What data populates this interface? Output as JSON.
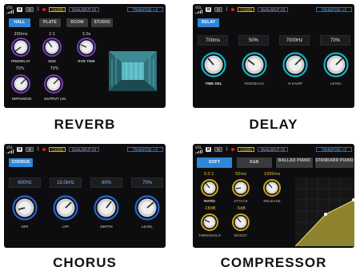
{
  "status": {
    "vol_label": "VOL",
    "h_chip": "H",
    "m_chip": "M",
    "bt_icon": "ᛒ",
    "chord": "CHORD",
    "dual": "DUAL/SPLIT CX",
    "transpose": "TRANSPOSE +0"
  },
  "reverb": {
    "tabs": [
      "HALL",
      "PLATE",
      "ROOM",
      "STUDIO"
    ],
    "values": [
      "200ms",
      "2:1",
      "3.0s",
      "70%",
      "70%"
    ],
    "labels": [
      "PREDELAY",
      "SIZE",
      "RVB TIME",
      "DIFFUSION",
      "OUTPUT LVL"
    ],
    "caption": "REVERB"
  },
  "delay": {
    "tab": "DELAY",
    "values": [
      "700ms",
      "50%",
      "7000Hz",
      "70%"
    ],
    "labels": [
      "TIME DEL",
      "FEEDBACK",
      "H DAMP",
      "LEVEL"
    ],
    "caption": "DELAY"
  },
  "chorus": {
    "tab": "CHORUS",
    "values": [
      "600Hz",
      "15.0kHz",
      "60%",
      "70%"
    ],
    "labels": [
      "HPF",
      "LPF",
      "DEPTH",
      "LEVEL"
    ],
    "caption": "CHORUS"
  },
  "compressor": {
    "tabs": [
      "SOFT",
      "R&B",
      "BALLAD PIANO",
      "STANDARD PIANO"
    ],
    "values": [
      "3.0:1",
      "50ms",
      "1000ms",
      "-18dB",
      "-5dB"
    ],
    "labels": [
      "RATIO",
      "ATTACK",
      "RELEASE",
      "THRESHOLD",
      "BOOST"
    ],
    "caption": "COMPRESSOR"
  },
  "colors": {
    "accent_blue": "#2e86d8",
    "reverb_knob_ring": "#7a3bbf",
    "delay_knob_ring": "#12b3c9",
    "chorus_knob_ring": "#2a63d1",
    "comp_knob_ring": "#c8a416",
    "chord_yellow": "#f3d200",
    "transpose_blue": "#58a8f0"
  }
}
